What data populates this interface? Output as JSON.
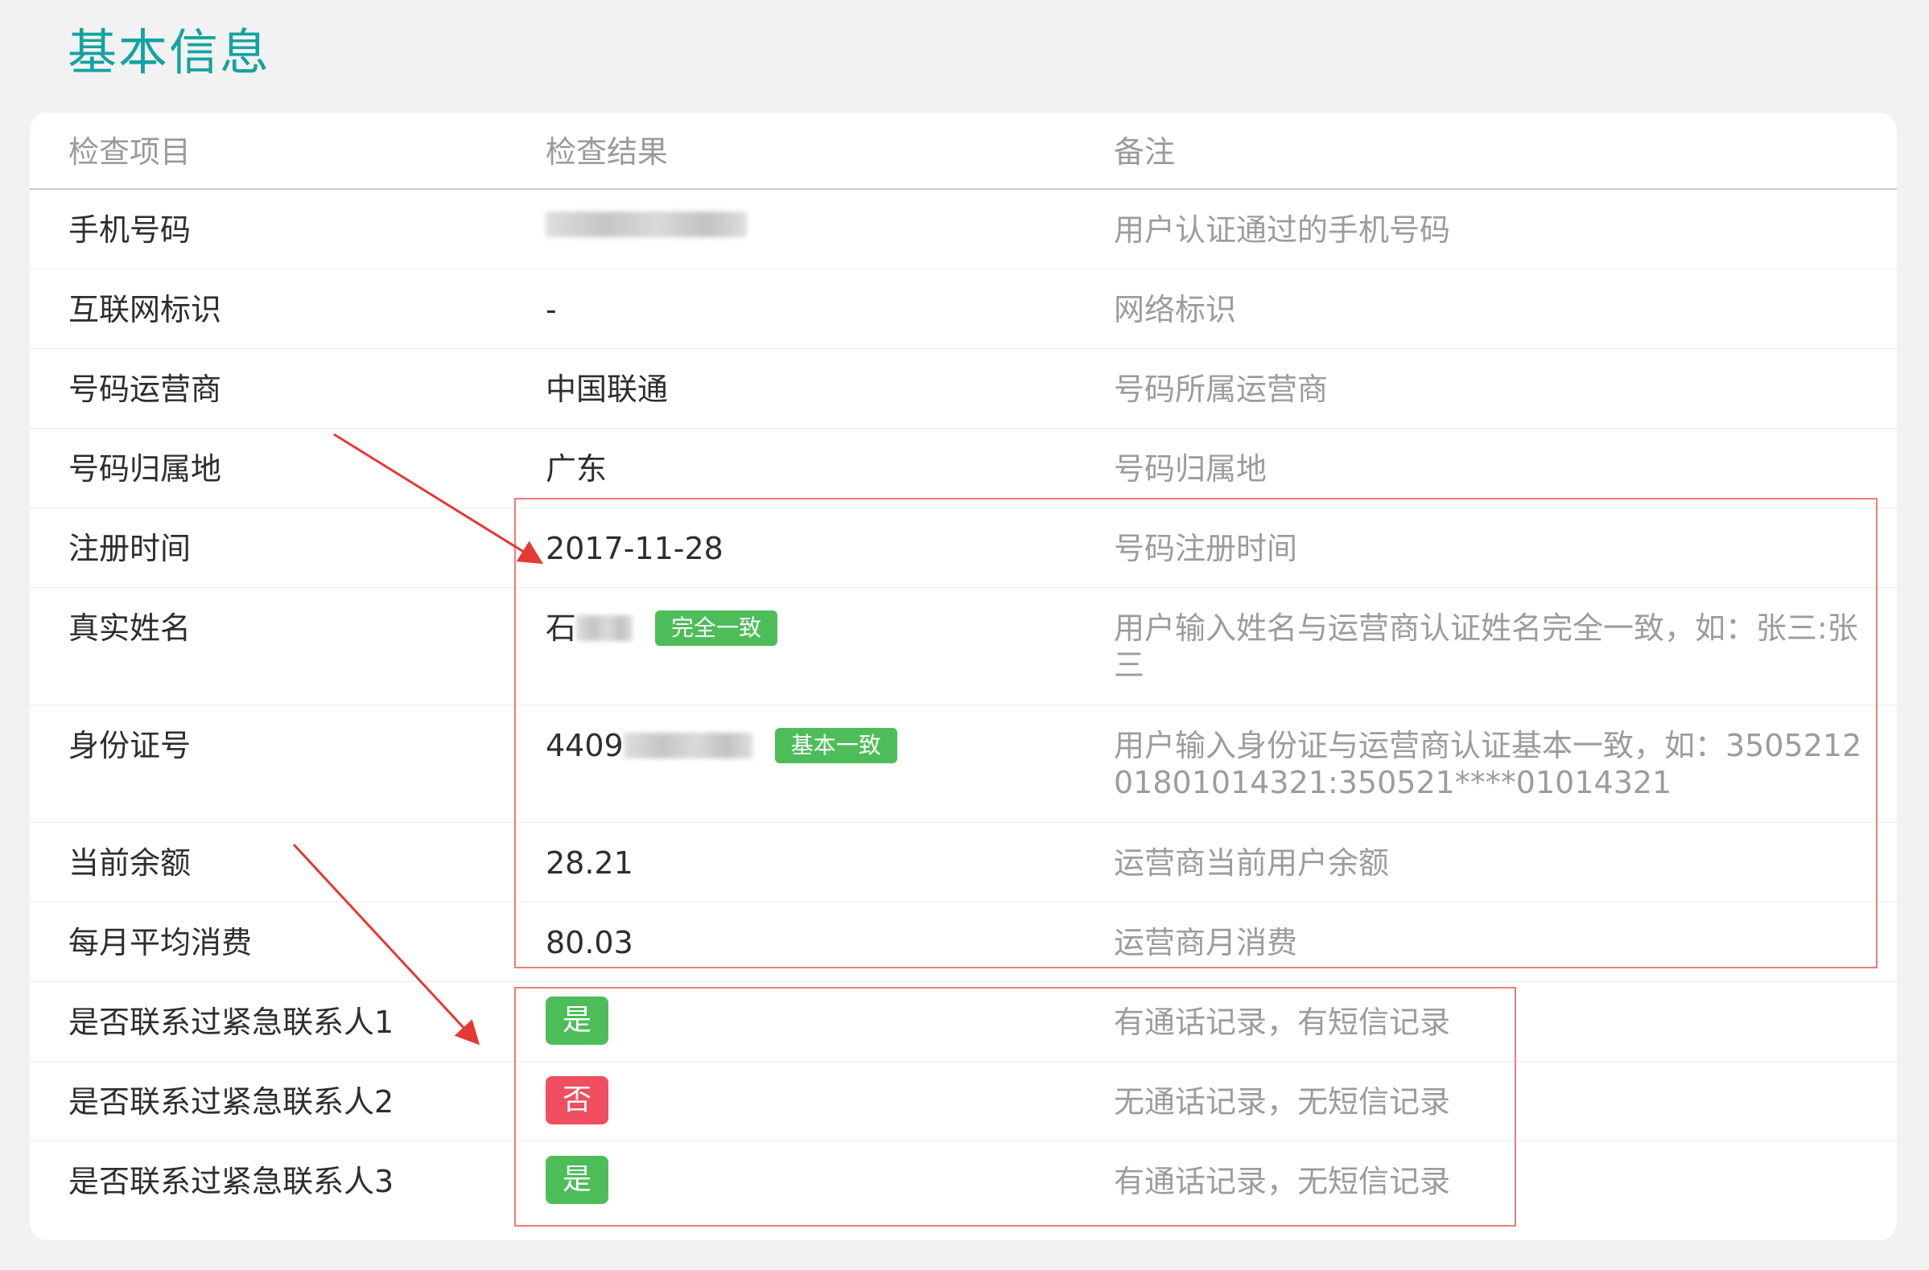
{
  "section": {
    "title": "基本信息"
  },
  "table": {
    "columns": [
      "检查项目",
      "检查结果",
      "备注"
    ],
    "rows": [
      {
        "item": "手机号码",
        "result": "",
        "note": "用户认证通过的手机号码"
      },
      {
        "item": "互联网标识",
        "result": "-",
        "note": "网络标识"
      },
      {
        "item": "号码运营商",
        "result": "中国联通",
        "note": "号码所属运营商"
      },
      {
        "item": "号码归属地",
        "result": "广东",
        "note": "号码归属地"
      },
      {
        "item": "注册时间",
        "result": "2017-11-28",
        "note": "号码注册时间"
      },
      {
        "item": "真实姓名",
        "result": "石",
        "tag": "完全一致",
        "note": "用户输入姓名与运营商认证姓名完全一致，如：张三:张三"
      },
      {
        "item": "身份证号",
        "result": "4409",
        "tag": "基本一致",
        "note": "用户输入身份证与运营商认证基本一致，如：350521201801014321:350521****01014321"
      },
      {
        "item": "当前余额",
        "result": "28.21",
        "note": "运营商当前用户余额"
      },
      {
        "item": "每月平均消费",
        "result": "80.03",
        "note": "运营商月消费"
      },
      {
        "item": "是否联系过紧急联系人1",
        "result": "是",
        "result_status": "yes",
        "note": "有通话记录，有短信记录"
      },
      {
        "item": "是否联系过紧急联系人2",
        "result": "否",
        "result_status": "no",
        "note": "无通话记录，无短信记录"
      },
      {
        "item": "是否联系过紧急联系人3",
        "result": "是",
        "result_status": "yes",
        "note": "有通话记录，无短信记录"
      }
    ]
  },
  "colors": {
    "title": "#14a3a0",
    "tag_green": "#4dbd5a",
    "tag_red": "#ef4f5e",
    "annotation_red": "#e53935"
  }
}
